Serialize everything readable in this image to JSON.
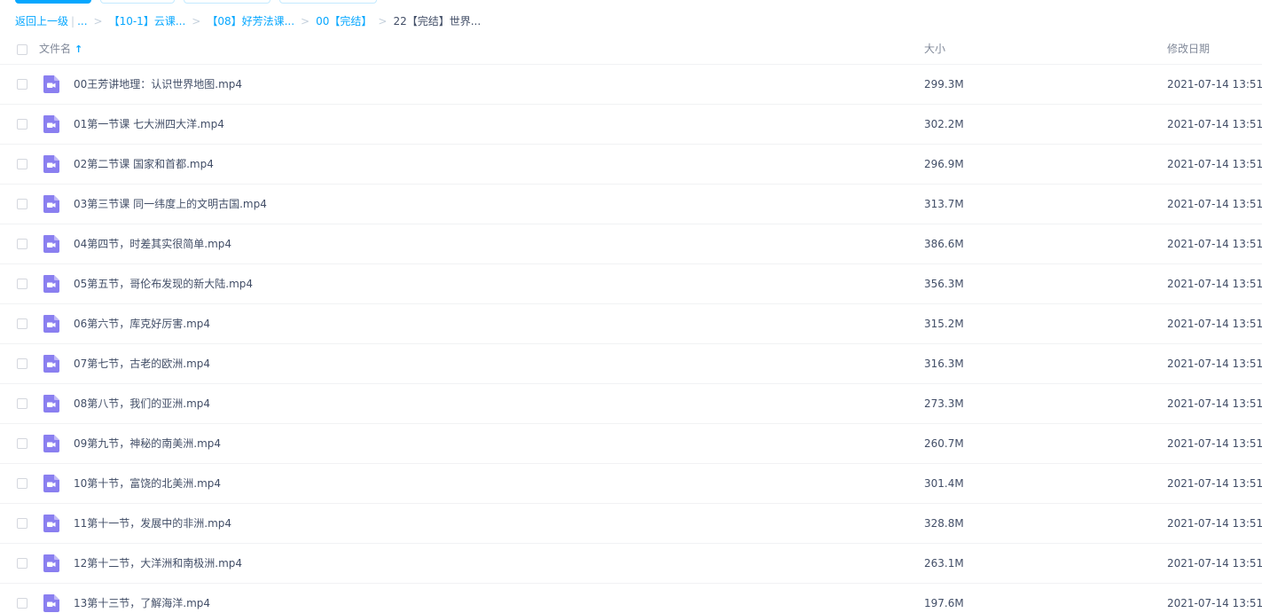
{
  "breadcrumb": {
    "back": "返回上一级",
    "ellipsis": "...",
    "items": [
      "【10-1】云课...",
      "【08】好芳法课...",
      "00【完结】"
    ],
    "current": "22【完结】世界...",
    "separator": ">",
    "bar": "|"
  },
  "header": {
    "name": "文件名",
    "sort_arrow": "↑",
    "size": "大小",
    "date": "修改日期"
  },
  "colors": {
    "accent": "#06a7ff",
    "video_icon": "#8a7ff0"
  },
  "files": [
    {
      "name": "00王芳讲地理：认识世界地图.mp4",
      "size": "299.3M",
      "date": "2021-07-14 13:51",
      "icon": "video-file-icon"
    },
    {
      "name": "01第一节课 七大洲四大洋.mp4",
      "size": "302.2M",
      "date": "2021-07-14 13:51",
      "icon": "video-file-icon"
    },
    {
      "name": "02第二节课 国家和首都.mp4",
      "size": "296.9M",
      "date": "2021-07-14 13:51",
      "icon": "video-file-icon"
    },
    {
      "name": "03第三节课 同一纬度上的文明古国.mp4",
      "size": "313.7M",
      "date": "2021-07-14 13:51",
      "icon": "video-file-icon"
    },
    {
      "name": "04第四节，时差其实很简单.mp4",
      "size": "386.6M",
      "date": "2021-07-14 13:51",
      "icon": "video-file-icon"
    },
    {
      "name": "05第五节，哥伦布发现的新大陆.mp4",
      "size": "356.3M",
      "date": "2021-07-14 13:51",
      "icon": "video-file-icon"
    },
    {
      "name": "06第六节，库克好厉害.mp4",
      "size": "315.2M",
      "date": "2021-07-14 13:51",
      "icon": "video-file-icon"
    },
    {
      "name": "07第七节，古老的欧洲.mp4",
      "size": "316.3M",
      "date": "2021-07-14 13:51",
      "icon": "video-file-icon"
    },
    {
      "name": "08第八节，我们的亚洲.mp4",
      "size": "273.3M",
      "date": "2021-07-14 13:51",
      "icon": "video-file-icon"
    },
    {
      "name": "09第九节，神秘的南美洲.mp4",
      "size": "260.7M",
      "date": "2021-07-14 13:51",
      "icon": "video-file-icon"
    },
    {
      "name": "10第十节，富饶的北美洲.mp4",
      "size": "301.4M",
      "date": "2021-07-14 13:51",
      "icon": "video-file-icon"
    },
    {
      "name": "11第十一节，发展中的非洲.mp4",
      "size": "328.8M",
      "date": "2021-07-14 13:51",
      "icon": "video-file-icon"
    },
    {
      "name": "12第十二节，大洋洲和南极洲.mp4",
      "size": "263.1M",
      "date": "2021-07-14 13:51",
      "icon": "video-file-icon"
    },
    {
      "name": "13第十三节，了解海洋.mp4",
      "size": "197.6M",
      "date": "2021-07-14 13:51",
      "icon": "video-file-icon"
    }
  ]
}
